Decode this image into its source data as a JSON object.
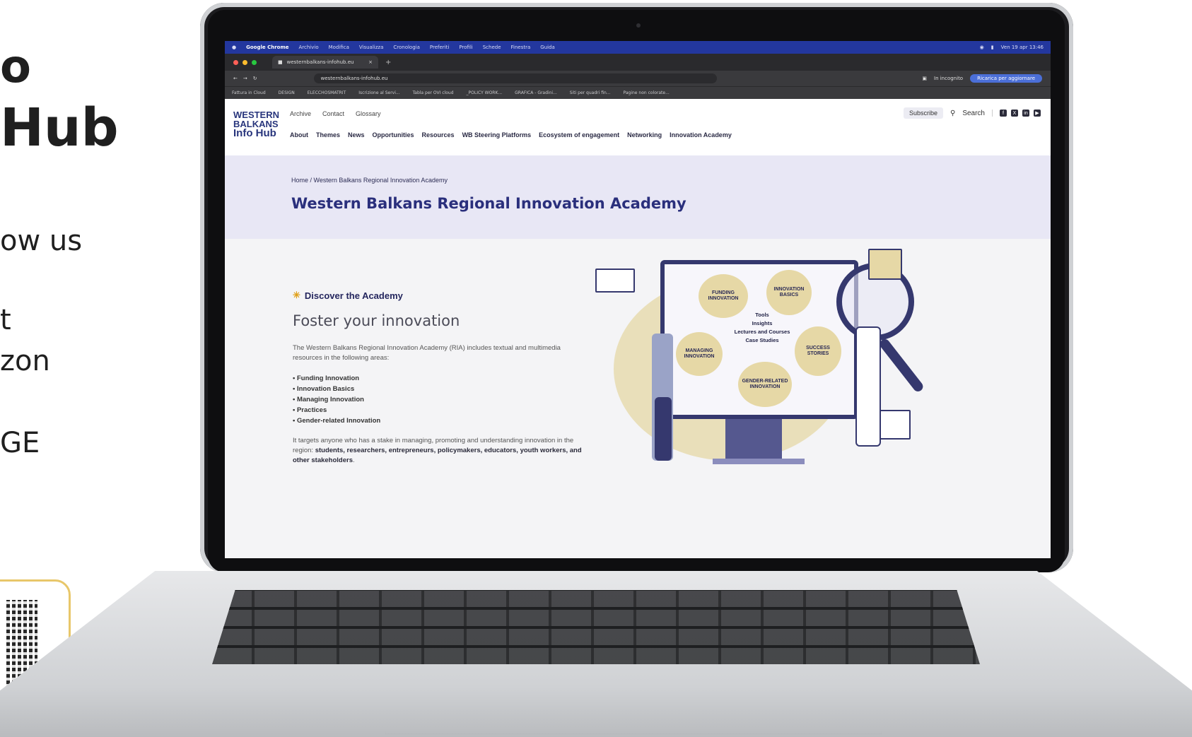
{
  "slide": {
    "line1": "o",
    "line2": "Hub",
    "line3": "ow us",
    "line4": "t",
    "line5": "zon",
    "line6": "GE"
  },
  "menubar": {
    "app": "Google Chrome",
    "items": [
      "Archivio",
      "Modifica",
      "Visualizza",
      "Cronologia",
      "Preferiti",
      "Profili",
      "Schede",
      "Finestra",
      "Guida"
    ],
    "clock": "Ven 19 apr 13:46"
  },
  "browser": {
    "tab_title": "westernbalkans-infohub.eu",
    "url": "westernbalkans-infohub.eu",
    "incognito_label": "In incognito",
    "reload_label": "Ricarica per aggiornare",
    "bookmarks": [
      "Fattura in Cloud",
      "DESIGN",
      "ELECCHOSMATRIT",
      "Iscrizione al Servi...",
      "Tabla per OVI cloud",
      "_POLICY WORK...",
      "GRAFICA - Gradini...",
      "Siti per quadri fin...",
      "Pagine non colorate..."
    ]
  },
  "site": {
    "logo": {
      "l1": "WESTERN",
      "l2": "BALKANS",
      "l3": "Info Hub"
    },
    "top_links": [
      "Archive",
      "Contact",
      "Glossary"
    ],
    "nav": [
      "About",
      "Themes",
      "News",
      "Opportunities",
      "Resources",
      "WB Steering Platforms",
      "Ecosystem of engagement",
      "Networking",
      "Innovation Academy"
    ],
    "subscribe": "Subscribe",
    "search": "Search",
    "social_icons": [
      "facebook-icon",
      "x-icon",
      "linkedin-icon",
      "youtube-icon"
    ]
  },
  "page": {
    "breadcrumb": "Home / Western Balkans Regional Innovation Academy",
    "title": "Western Balkans Regional Innovation Academy",
    "discover": "Discover the Academy",
    "heading": "Foster your innovation",
    "intro": "The Western Balkans Regional Innovation Academy (RIA) includes textual and multimedia resources in the following areas:",
    "areas": [
      "Funding Innovation",
      "Innovation Basics",
      "Managing Innovation",
      "Practices",
      "Gender-related Innovation"
    ],
    "target_pre": "It targets anyone who has a stake in managing, promoting and understanding innovation in the region: ",
    "target_bold": "students, researchers, entrepreneurs, policymakers, educators, youth workers, and other stakeholders",
    "target_post": "."
  },
  "illustration": {
    "blobs": {
      "funding": "FUNDING INNOVATION",
      "basics": "INNOVATION BASICS",
      "managing": "MANAGING INNOVATION",
      "success": "SUCCESS STORIES",
      "gender": "GENDER-RELATED INNOVATION"
    },
    "center": [
      "Tools",
      "Insights",
      "Lectures and Courses",
      "Case Studies"
    ]
  }
}
